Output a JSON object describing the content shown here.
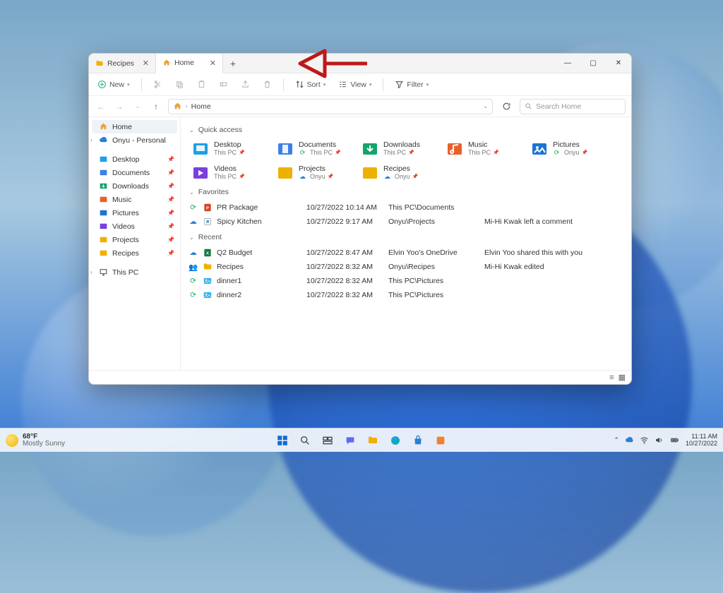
{
  "titlebar": {
    "tabs": [
      {
        "label": "Recipes",
        "icon": "folder-icon"
      },
      {
        "label": "Home",
        "icon": "home-icon"
      }
    ],
    "new_tab_tooltip": "+"
  },
  "toolbar": {
    "new_label": "New",
    "sort_label": "Sort",
    "view_label": "View",
    "filter_label": "Filter"
  },
  "address": {
    "root_icon": "home",
    "segments": [
      "Home"
    ]
  },
  "search": {
    "placeholder": "Search Home"
  },
  "sidebar": {
    "top": [
      {
        "label": "Home",
        "icon": "home",
        "selected": true
      },
      {
        "label": "Onyu - Personal",
        "icon": "onedrive",
        "expandable": true
      }
    ],
    "quick": [
      {
        "label": "Desktop",
        "icon": "desktop",
        "pinned": true
      },
      {
        "label": "Documents",
        "icon": "documents",
        "pinned": true
      },
      {
        "label": "Downloads",
        "icon": "downloads",
        "pinned": true
      },
      {
        "label": "Music",
        "icon": "music",
        "pinned": true
      },
      {
        "label": "Pictures",
        "icon": "pictures",
        "pinned": true
      },
      {
        "label": "Videos",
        "icon": "videos",
        "pinned": true
      },
      {
        "label": "Projects",
        "icon": "folder",
        "pinned": true
      },
      {
        "label": "Recipes",
        "icon": "folder",
        "pinned": true
      }
    ],
    "bottom": [
      {
        "label": "This PC",
        "icon": "thispc",
        "expandable": true
      }
    ]
  },
  "sections": {
    "quick_access": "Quick access",
    "favorites": "Favorites",
    "recent": "Recent"
  },
  "quick_access": [
    {
      "label": "Desktop",
      "sub": "This PC",
      "color": "#1e9fe8",
      "icon": "desktop"
    },
    {
      "label": "Documents",
      "sub": "This PC",
      "color": "#3e7ee8",
      "icon": "documents",
      "sync": true
    },
    {
      "label": "Downloads",
      "sub": "This PC",
      "color": "#12a66a",
      "icon": "downloads"
    },
    {
      "label": "Music",
      "sub": "This PC",
      "color": "#e8612a",
      "icon": "music"
    },
    {
      "label": "Pictures",
      "sub": "Onyu",
      "color": "#1d74d4",
      "icon": "pictures",
      "sync": true
    },
    {
      "label": "Videos",
      "sub": "This PC",
      "color": "#7a3fe0",
      "icon": "videos"
    },
    {
      "label": "Projects",
      "sub": "Onyu",
      "color": "#f0b000",
      "icon": "folder",
      "cloud": true
    },
    {
      "label": "Recipes",
      "sub": "Onyu",
      "color": "#f0b000",
      "icon": "folder",
      "cloud": true
    }
  ],
  "favorites": [
    {
      "name": "PR Package",
      "date": "10/27/2022 10:14 AM",
      "loc": "This PC\\Documents",
      "note": "",
      "icon": "ppt",
      "status": "sync"
    },
    {
      "name": "Spicy Kitchen",
      "date": "10/27/2022 9:17 AM",
      "loc": "Onyu\\Projects",
      "note": "Mi-Hi Kwak left a comment",
      "icon": "link",
      "status": "cloud"
    }
  ],
  "recent": [
    {
      "name": "Q2 Budget",
      "date": "10/27/2022 8:47 AM",
      "loc": "Elvin Yoo's OneDrive",
      "note": "Elvin Yoo shared this with you",
      "icon": "xls",
      "status": "cloud"
    },
    {
      "name": "Recipes",
      "date": "10/27/2022 8:32 AM",
      "loc": "Onyu\\Recipes",
      "note": "Mi-Hi Kwak edited",
      "icon": "folder",
      "status": "shared"
    },
    {
      "name": "dinner1",
      "date": "10/27/2022 8:32 AM",
      "loc": "This PC\\Pictures",
      "note": "",
      "icon": "img",
      "status": "sync"
    },
    {
      "name": "dinner2",
      "date": "10/27/2022 8:32 AM",
      "loc": "This PC\\Pictures",
      "note": "",
      "icon": "img",
      "status": "sync"
    }
  ],
  "taskbar": {
    "weather_temp": "68°F",
    "weather_desc": "Mostly Sunny",
    "time": "11:11 AM",
    "date": "10/27/2022"
  }
}
